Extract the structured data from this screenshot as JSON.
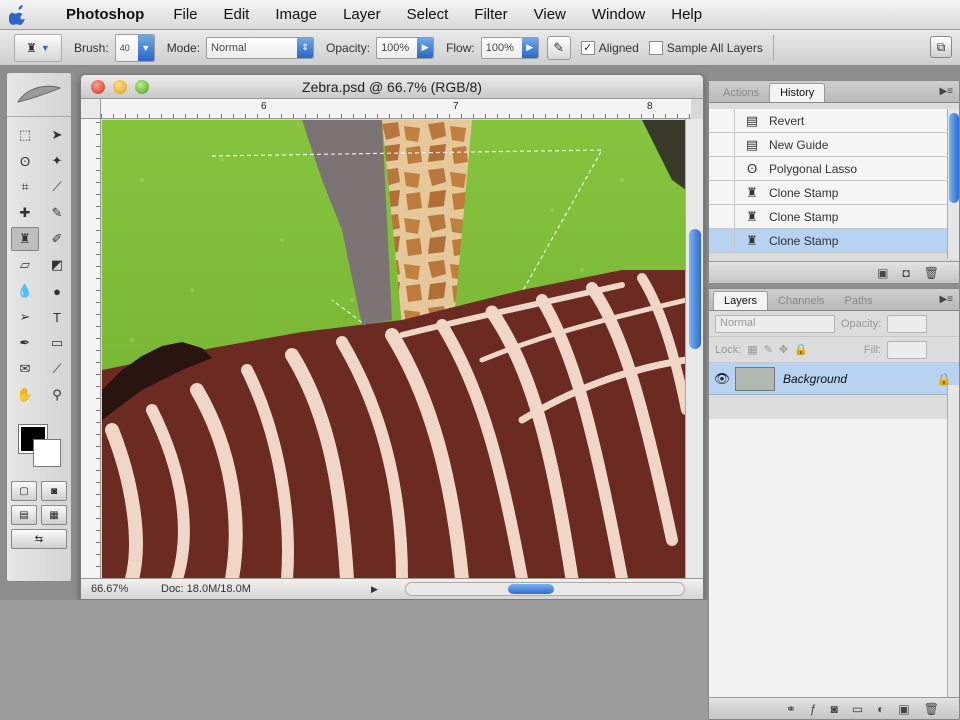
{
  "menubar": {
    "app": "Photoshop",
    "items": [
      "File",
      "Edit",
      "Image",
      "Layer",
      "Select",
      "Filter",
      "View",
      "Window",
      "Help"
    ]
  },
  "options": {
    "brush_label": "Brush:",
    "brush_size": "40",
    "mode_label": "Mode:",
    "mode_value": "Normal",
    "opacity_label": "Opacity:",
    "opacity_value": "100%",
    "flow_label": "Flow:",
    "flow_value": "100%",
    "aligned_label": "Aligned",
    "aligned_checked": true,
    "sample_all_label": "Sample All Layers",
    "sample_all_checked": false
  },
  "document": {
    "title": "Zebra.psd @ 66.7% (RGB/8)",
    "zoom": "66.67%",
    "doc_info": "Doc: 18.0M/18.0M",
    "ruler_numbers": [
      "6",
      "7",
      "8"
    ]
  },
  "history": {
    "tabs": [
      "Actions",
      "History"
    ],
    "active_tab": "History",
    "items": [
      {
        "icon": "document-icon",
        "label": "Revert"
      },
      {
        "icon": "document-icon",
        "label": "New Guide"
      },
      {
        "icon": "lasso-icon",
        "label": "Polygonal Lasso"
      },
      {
        "icon": "stamp-icon",
        "label": "Clone Stamp"
      },
      {
        "icon": "stamp-icon",
        "label": "Clone Stamp"
      },
      {
        "icon": "stamp-icon",
        "label": "Clone Stamp"
      }
    ],
    "selected_index": 5
  },
  "layers": {
    "tabs": [
      "Layers",
      "Channels",
      "Paths"
    ],
    "active_tab": "Layers",
    "blend_mode": "Normal",
    "opacity_label": "Opacity:",
    "lock_label": "Lock:",
    "fill_label": "Fill:",
    "layer_name": "Background"
  },
  "colors": {
    "selection": "#b8d2f2",
    "accent": "#2d6bd0",
    "grass": "#7fbf3a",
    "zebra_dark": "#6b2a22",
    "zebra_light": "#f0d6c6"
  }
}
